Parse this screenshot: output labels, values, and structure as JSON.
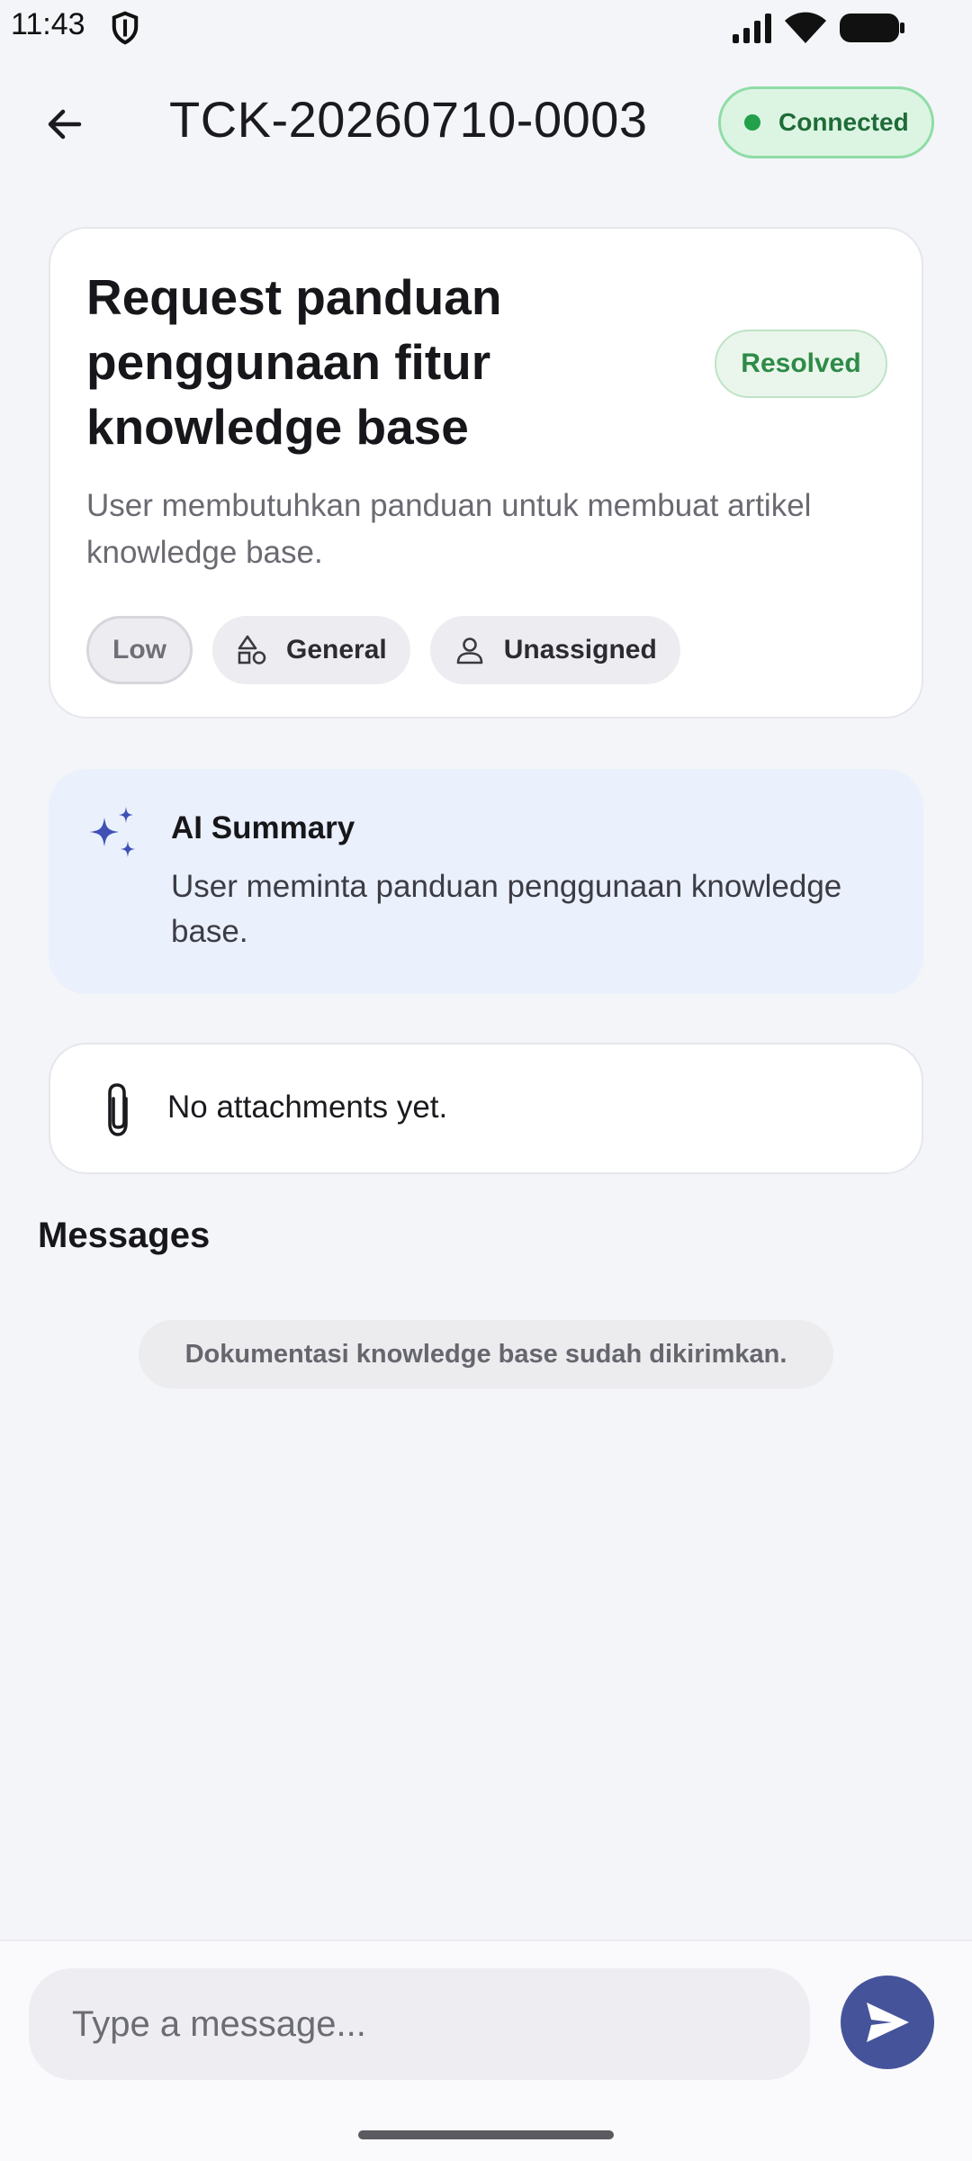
{
  "status_bar": {
    "time": "11:43",
    "icons": [
      "shield-icon",
      "signal-icon",
      "wifi-icon",
      "battery-icon"
    ]
  },
  "header": {
    "back_icon": "arrow-left-icon",
    "ticket_id": "TCK-20260710-0003",
    "connection_status": "Connected",
    "connection_color": "#22a04a"
  },
  "ticket": {
    "title": "Request panduan penggunaan fitur knowledge base",
    "status": "Resolved",
    "status_color": "#2e8b47",
    "description": "User membutuhkan panduan untuk membuat artikel knowledge base.",
    "tags": {
      "priority": "Low",
      "category": "General",
      "category_icon": "shapes-icon",
      "assignee": "Unassigned",
      "assignee_icon": "person-icon"
    }
  },
  "ai_summary": {
    "icon": "sparkles-icon",
    "title": "AI Summary",
    "text": "User meminta panduan penggunaan knowledge base."
  },
  "attachments": {
    "icon": "paperclip-icon",
    "empty_text": "No attachments yet."
  },
  "messages": {
    "heading": "Messages",
    "items": [
      {
        "text": "Dokumentasi knowledge base sudah dikirimkan."
      }
    ]
  },
  "composer": {
    "placeholder": "Type a message...",
    "send_icon": "send-icon",
    "accent": "#45549a"
  }
}
